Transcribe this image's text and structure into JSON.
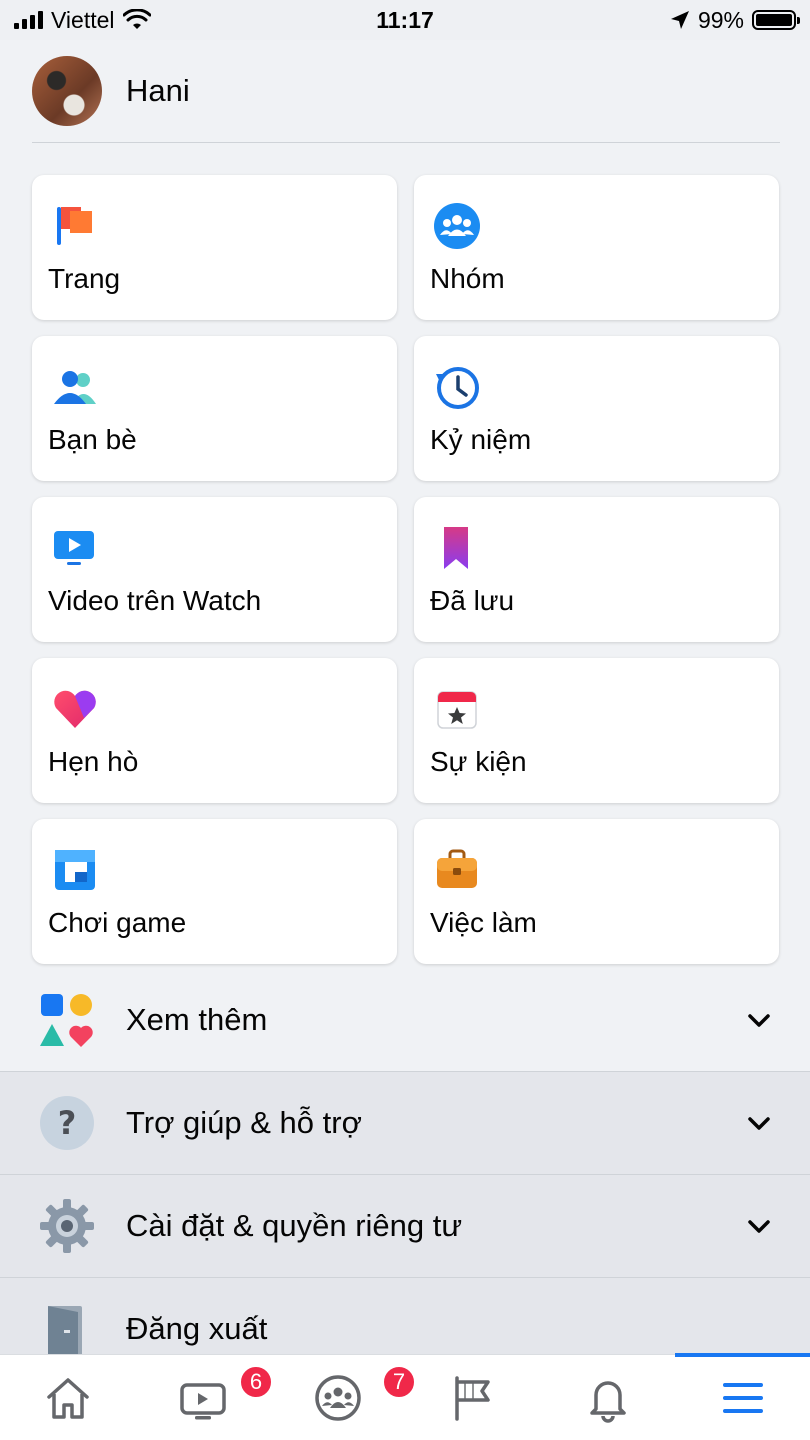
{
  "status_bar": {
    "carrier": "Viettel",
    "time": "11:17",
    "battery": "99%"
  },
  "profile": {
    "name": "Hani"
  },
  "shortcuts": [
    {
      "label": "Trang",
      "icon": "flag-icon"
    },
    {
      "label": "Nhóm",
      "icon": "groups-icon"
    },
    {
      "label": "Bạn bè",
      "icon": "friends-icon"
    },
    {
      "label": "Kỷ niệm",
      "icon": "memories-clock-icon"
    },
    {
      "label": "Video trên Watch",
      "icon": "watch-video-icon"
    },
    {
      "label": "Đã lưu",
      "icon": "bookmark-icon"
    },
    {
      "label": "Hẹn hò",
      "icon": "heart-icon"
    },
    {
      "label": "Sự kiện",
      "icon": "calendar-star-icon"
    },
    {
      "label": "Chơi game",
      "icon": "gaming-icon"
    },
    {
      "label": "Việc làm",
      "icon": "briefcase-icon"
    }
  ],
  "rows": {
    "more": "Xem thêm",
    "help": "Trợ giúp & hỗ trợ",
    "settings": "Cài đặt & quyền riêng tư",
    "logout": "Đăng xuất"
  },
  "tab_bar": {
    "watch_badge": "6",
    "groups_badge": "7",
    "active_tab": "menu"
  },
  "colors": {
    "accent": "#1877f2",
    "badge": "#f02849",
    "background": "#f0f2f5"
  }
}
